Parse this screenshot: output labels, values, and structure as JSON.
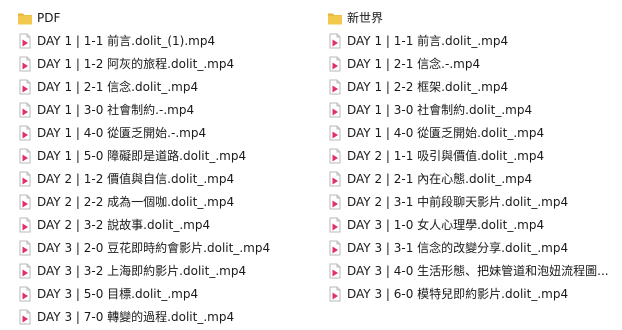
{
  "colors": {
    "folder": "#f2c94c",
    "folder_tab": "#e4b43a",
    "video_accent": "#e0306b"
  },
  "columns": [
    {
      "folder": {
        "icon": "folder-icon",
        "label": "PDF"
      },
      "files": [
        "DAY 1 | 1-1 前言.dolit_(1).mp4",
        "DAY 1 | 1-2 阿灰的旅程.dolit_.mp4",
        "DAY 1 | 2-1 信念.dolit_.mp4",
        "DAY 1 | 3-0 社會制約.-.mp4",
        "DAY 1 | 4-0 從匱乏開始.-.mp4",
        "DAY 1 | 5-0 障礙即是道路.dolit_.mp4",
        "DAY 2 | 1-2 價值與自信.dolit_.mp4",
        "DAY 2 | 2-2 成為一個咖.dolit_.mp4",
        "DAY 2 | 3-2 說故事.dolit_.mp4",
        "DAY 3 | 2-0 豆花即時約會影片.dolit_.mp4",
        "DAY 3 | 3-2 上海即約影片.dolit_.mp4",
        "DAY 3 | 5-0 目標.dolit_.mp4",
        "DAY 3 | 7-0 轉變的過程.dolit_.mp4"
      ]
    },
    {
      "folder": {
        "icon": "folder-icon",
        "label": "新世界"
      },
      "files": [
        "DAY 1 | 1-1 前言.dolit_.mp4",
        "DAY 1 | 2-1 信念.-.mp4",
        "DAY 1 | 2-2 框架.dolit_.mp4",
        "DAY 1 | 3-0 社會制約.dolit_.mp4",
        "DAY 1 | 4-0 從匱乏開始.dolit_.mp4",
        "DAY 2 | 1-1 吸引與價值.dolit_.mp4",
        "DAY 2 | 2-1 內在心態.dolit_.mp4",
        "DAY 2 | 3-1 中前段聊天影片.dolit_.mp4",
        "DAY 3 | 1-0 女人心理學.dolit_.mp4",
        "DAY 3 | 3-1 信念的改變分享.dolit_.mp4",
        "DAY 3 | 4-0 生活形態、把妹管道和泡妞流程圖...",
        "DAY 3 | 6-0 模特兒即約影片.dolit_.mp4"
      ]
    }
  ],
  "file_icon": "video-file-icon"
}
